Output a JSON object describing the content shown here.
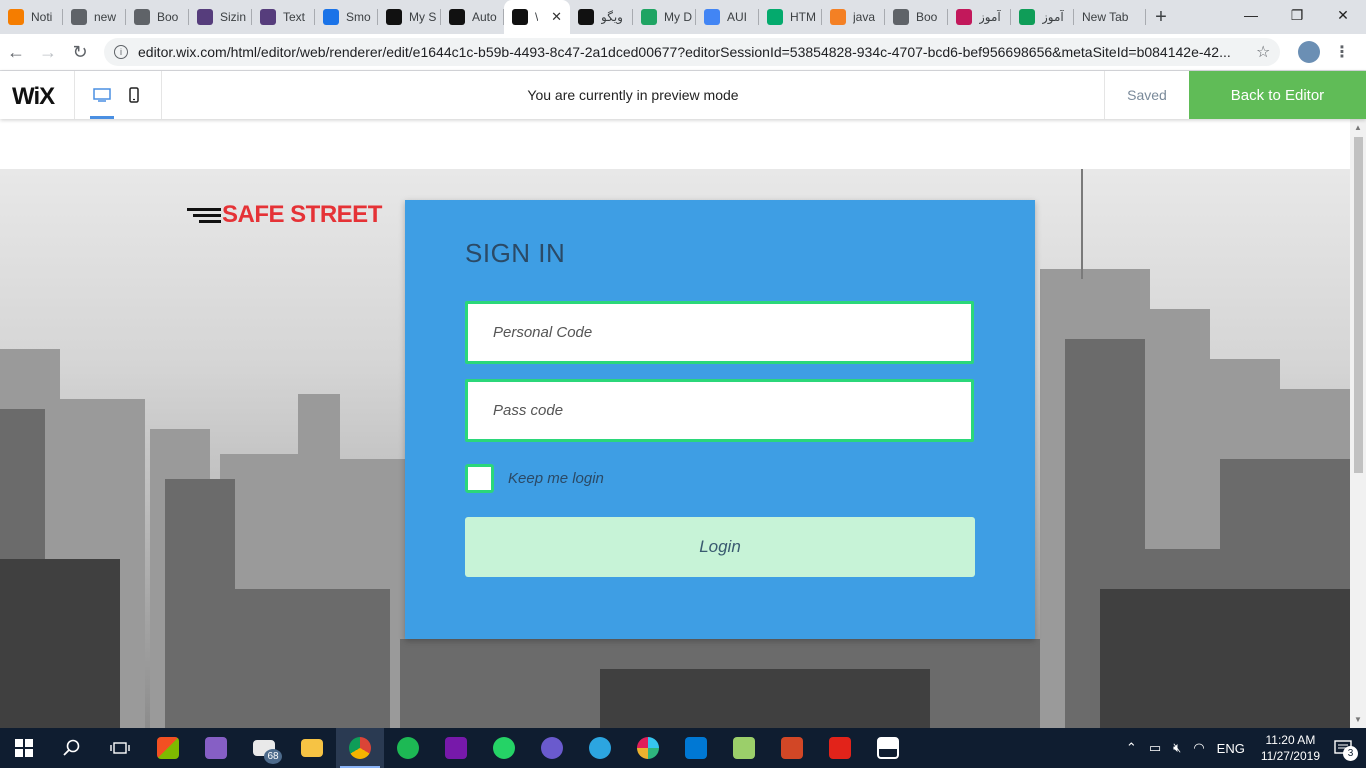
{
  "browser": {
    "tabs": [
      {
        "title": "Noti",
        "favicon": "blogger-icon",
        "color": "#f57d00"
      },
      {
        "title": "new",
        "favicon": "globe-icon",
        "color": "#5f6368"
      },
      {
        "title": "Boo",
        "favicon": "globe-icon",
        "color": "#5f6368"
      },
      {
        "title": "Sizin",
        "favicon": "bootstrap-icon",
        "color": "#563d7c"
      },
      {
        "title": "Text",
        "favicon": "bootstrap-icon",
        "color": "#563d7c"
      },
      {
        "title": "Smo",
        "favicon": "info-icon",
        "color": "#1a73e8"
      },
      {
        "title": "My S",
        "favicon": "wix-icon",
        "color": "#111111"
      },
      {
        "title": "Auto",
        "favicon": "wix-icon",
        "color": "#111111"
      },
      {
        "title": "\\",
        "favicon": "wix-icon",
        "color": "#111111",
        "active": true
      },
      {
        "title": "ویگو",
        "favicon": "jq-icon",
        "color": "#111111"
      },
      {
        "title": "My D",
        "favicon": "drive-icon",
        "color": "#1fa463"
      },
      {
        "title": "AUI",
        "favicon": "docs-icon",
        "color": "#4285f4"
      },
      {
        "title": "HTM",
        "favicon": "w3schools-icon",
        "color": "#04aa6d"
      },
      {
        "title": "java",
        "favicon": "stackoverflow-icon",
        "color": "#f48024"
      },
      {
        "title": "Boo",
        "favicon": "globe-icon",
        "color": "#5f6368"
      },
      {
        "title": "آموز",
        "favicon": "o-icon",
        "color": "#c2185b"
      },
      {
        "title": "آموز",
        "favicon": "diamond-icon",
        "color": "#0f9d58"
      },
      {
        "title": "New Tab",
        "favicon": "",
        "color": "#dee1e6"
      }
    ],
    "new_tab_symbol": "+",
    "url": "editor.wix.com/html/editor/web/renderer/edit/e1644c1c-b59b-4493-8c47-2a1dced00677?editorSessionId=53854828-934c-4707-bcd6-bef956698656&metaSiteId=b084142e-42..."
  },
  "wix_bar": {
    "logo": "WiX",
    "preview_message": "You are currently in preview mode",
    "saved_label": "Saved",
    "back_label": "Back to Editor"
  },
  "site": {
    "logo_text": "SAFE STREET",
    "signin_title": "SIGN IN",
    "personal_code_placeholder": "Personal Code",
    "pass_code_placeholder": "Pass code",
    "keep_login_label": "Keep me login",
    "login_label": "Login"
  },
  "taskbar": {
    "mail_badge": "68",
    "lang": "ENG",
    "time": "11:20 AM",
    "date": "11/27/2019",
    "notif_count": "3"
  },
  "colors": {
    "card": "#3e9ee4",
    "field_border": "#2bd77a",
    "login_button": "#c7f3d7",
    "back_button": "#60bc57",
    "logo_red": "#e53236"
  }
}
